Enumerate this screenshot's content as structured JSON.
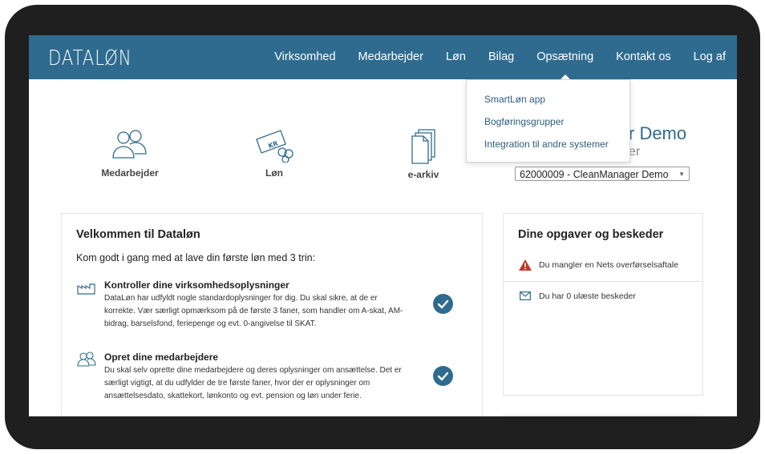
{
  "header": {
    "logo": "DATALØN",
    "nav": [
      {
        "label": "Virksomhed"
      },
      {
        "label": "Medarbejder"
      },
      {
        "label": "Løn"
      },
      {
        "label": "Bilag"
      },
      {
        "label": "Opsætning"
      },
      {
        "label": "Kontakt os"
      },
      {
        "label": "Log af"
      }
    ]
  },
  "dropdown": {
    "items": [
      {
        "label": "SmartLøn app"
      },
      {
        "label": "Bogføringsgrupper"
      },
      {
        "label": "Integration til andre systemer"
      }
    ]
  },
  "quick_links": [
    {
      "label": "Medarbejder",
      "icon": "people-icon"
    },
    {
      "label": "Løn",
      "icon": "money-icon"
    },
    {
      "label": "e-arkiv",
      "icon": "documents-icon"
    }
  ],
  "company": {
    "title_fragment": "r Demo",
    "subtitle_fragment": "er",
    "select_value": "62000009 - CleanManager Demo"
  },
  "welcome": {
    "title": "Velkommen til Dataløn",
    "intro": "Kom godt i gang med at lave din første løn med 3 trin:",
    "steps": [
      {
        "title": "Kontroller dine virksomhedsoplysninger",
        "body": "DataLøn har udfyldt nogle standardoplysninger for dig. Du skal sikre, at de er korrekte. Vær særligt opmærksom på de første 3 faner, som handler om A-skat, AM-bidrag, barselsfond, feriepenge og evt. 0-angivelse til SKAT.",
        "icon": "factory-icon"
      },
      {
        "title": "Opret dine medarbejdere",
        "body": "Du skal selv oprette dine medarbejdere og deres oplysninger om ansættelse. Det er særligt vigtigt, at du udfylder de tre første faner, hvor der er oplysninger om ansættelsesdato, skattekort, lønkonto og evt. pension og løn under ferie.",
        "icon": "people-icon"
      }
    ]
  },
  "tasks": {
    "title": "Dine opgaver og beskeder",
    "items": [
      {
        "text": "Du mangler en Nets overførselsaftale",
        "icon": "warning-icon"
      },
      {
        "text": "Du har 0 ulæste beskeder",
        "icon": "mail-icon"
      }
    ]
  },
  "colors": {
    "header": "#2f6b8f",
    "warning": "#c0392b"
  }
}
